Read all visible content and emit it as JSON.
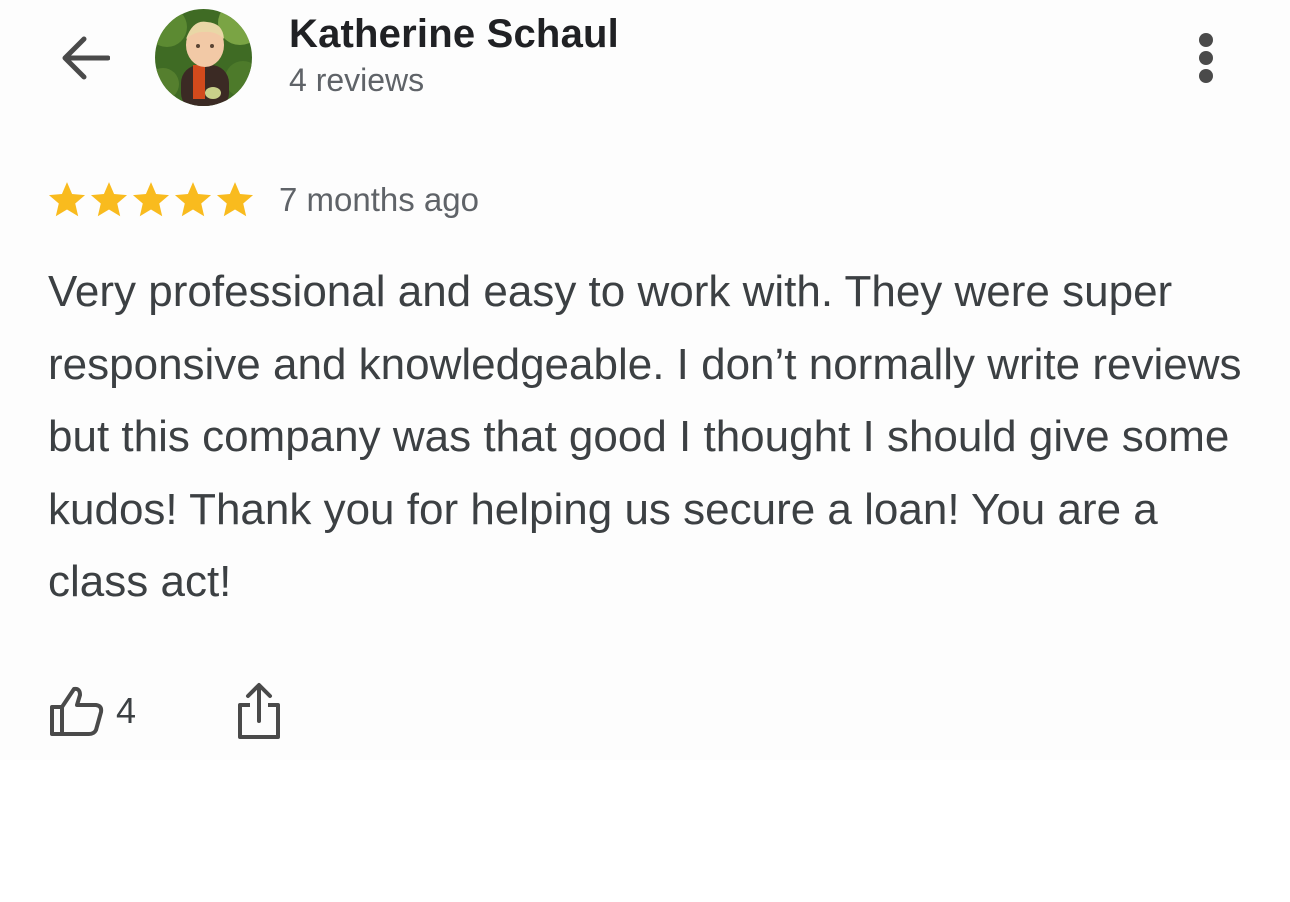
{
  "reviewer": {
    "name": "Katherine Schaul",
    "review_count": "4 reviews"
  },
  "review": {
    "rating": 5,
    "max_rating": 5,
    "age": "7 months ago",
    "text": "Very professional and easy to work with. They were super responsive and knowledgeable. I don’t normally write reviews but this company was that good I thought I should give some kudos! Thank you for helping us secure a loan! You are a class act!",
    "likes": "4"
  },
  "icons": {
    "back": "back-arrow-icon",
    "more": "more-vert-icon",
    "star": "star-icon",
    "like": "thumb-up-icon",
    "share": "share-icon"
  },
  "colors": {
    "star": "#F9BB1E",
    "icon": "#4a4a4a",
    "name": "#202124",
    "text": "#3c4043",
    "secondary": "#5f6368"
  }
}
